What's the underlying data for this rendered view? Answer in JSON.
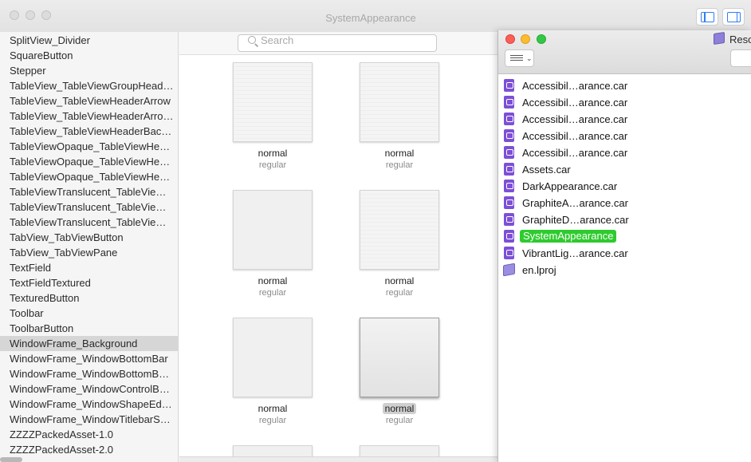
{
  "main_window": {
    "title": "SystemAppearance",
    "search_placeholder": "Search",
    "sidebar_items": [
      "SplitView_Divider",
      "SquareButton",
      "Stepper",
      "TableView_TableViewGroupHead…",
      "TableView_TableViewHeaderArrow",
      "TableView_TableViewHeaderArro…",
      "TableView_TableViewHeaderBac…",
      "TableViewOpaque_TableViewHe…",
      "TableViewOpaque_TableViewHe…",
      "TableViewOpaque_TableViewHe…",
      "TableViewTranslucent_TableVie…",
      "TableViewTranslucent_TableVie…",
      "TableViewTranslucent_TableVie…",
      "TabView_TabViewButton",
      "TabView_TabViewPane",
      "TextField",
      "TextFieldTextured",
      "TexturedButton",
      "Toolbar",
      "ToolbarButton",
      "WindowFrame_Background",
      "WindowFrame_WindowBottomBar",
      "WindowFrame_WindowBottomB…",
      "WindowFrame_WindowControlB…",
      "WindowFrame_WindowShapeEd…",
      "WindowFrame_WindowTitlebarS…",
      "ZZZZPackedAsset-1.0",
      "ZZZZPackedAsset-2.0"
    ],
    "selected_sidebar_item": "WindowFrame_Background",
    "tiles": [
      {
        "name": "normal",
        "subtitle": "regular"
      },
      {
        "name": "normal",
        "subtitle": "regular"
      },
      {
        "name": "normal",
        "subtitle": "regular"
      },
      {
        "name": "normal",
        "subtitle": "regular"
      },
      {
        "name": "normal",
        "subtitle": "regular"
      },
      {
        "name": "normal",
        "subtitle": "regular"
      }
    ],
    "selected_tile_index": 5
  },
  "finder_window": {
    "title": "Reso",
    "files": [
      {
        "name": "Accessibil…arance.car",
        "icon": "car-file-icon"
      },
      {
        "name": "Accessibil…arance.car",
        "icon": "car-file-icon"
      },
      {
        "name": "Accessibil…arance.car",
        "icon": "car-file-icon"
      },
      {
        "name": "Accessibil…arance.car",
        "icon": "car-file-icon"
      },
      {
        "name": "Accessibil…arance.car",
        "icon": "car-file-icon"
      },
      {
        "name": "Assets.car",
        "icon": "car-file-icon"
      },
      {
        "name": "DarkAppearance.car",
        "icon": "car-file-icon"
      },
      {
        "name": "GraphiteA…arance.car",
        "icon": "car-file-icon"
      },
      {
        "name": "GraphiteD…arance.car",
        "icon": "car-file-icon"
      },
      {
        "name": "SystemAppearance",
        "icon": "car-file-icon"
      },
      {
        "name": "VibrantLig…arance.car",
        "icon": "car-file-icon"
      },
      {
        "name": "en.lproj",
        "icon": "folder-icon"
      }
    ],
    "selected_file_index": 9,
    "selection_color": "#2ecb2e"
  }
}
